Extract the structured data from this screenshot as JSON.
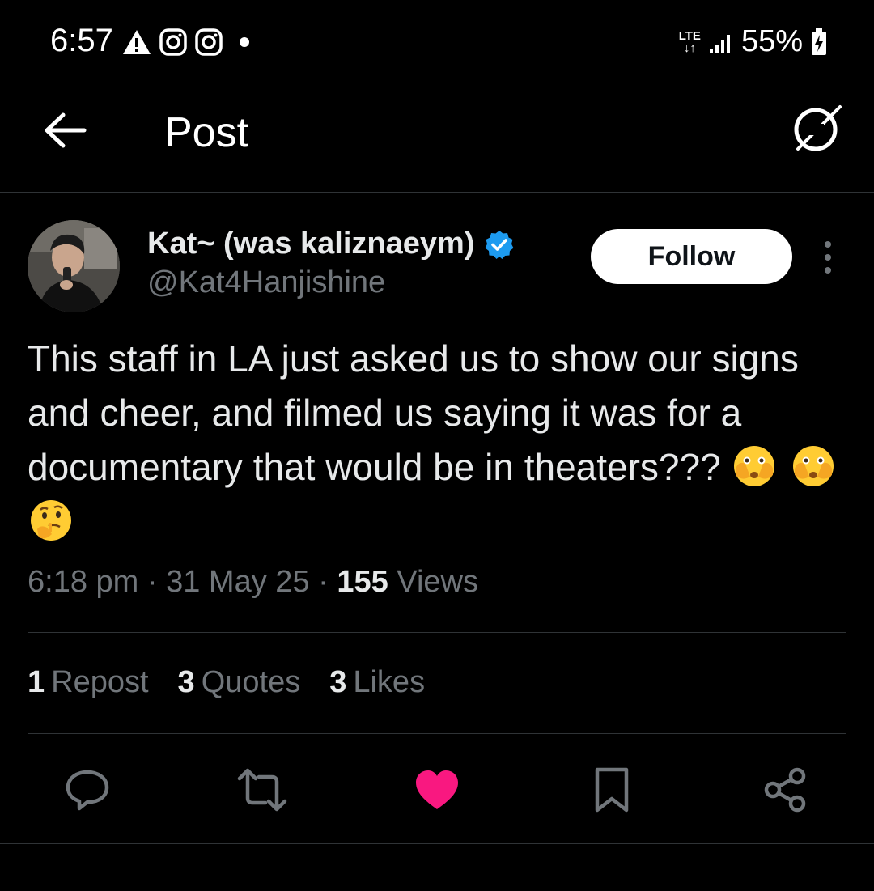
{
  "status_bar": {
    "time": "6:57",
    "network": "LTE",
    "battery": "55%"
  },
  "header": {
    "title": "Post"
  },
  "author": {
    "display_name": "Kat~ (was kaliznaeym)",
    "handle": "@Kat4Hanjishine",
    "verified": true
  },
  "follow_label": "Follow",
  "post": {
    "text": "This staff in LA just asked us to show our signs and cheer, and filmed us saying it was for a documentary that would be in theaters???",
    "emojis": [
      "face-with-open-eyes-and-hand-over-mouth",
      "face-with-open-eyes-and-hand-over-mouth",
      "thinking-face"
    ]
  },
  "meta": {
    "time": "6:18 pm",
    "sep1": "·",
    "date": "31 May 25",
    "sep2": "·",
    "views_count": "155",
    "views_label": "Views"
  },
  "stats": {
    "reposts_count": "1",
    "reposts_label": "Repost",
    "quotes_count": "3",
    "quotes_label": "Quotes",
    "likes_count": "3",
    "likes_label": "Likes"
  },
  "actions": {
    "reply_icon": "reply-icon",
    "repost_icon": "repost-icon",
    "like_icon": "heart-icon",
    "bookmark_icon": "bookmark-icon",
    "share_icon": "share-icon"
  },
  "colors": {
    "background": "#000000",
    "text": "#e7e9ea",
    "secondary": "#71767b",
    "verified": "#1d9bf0",
    "like": "#f91880"
  }
}
